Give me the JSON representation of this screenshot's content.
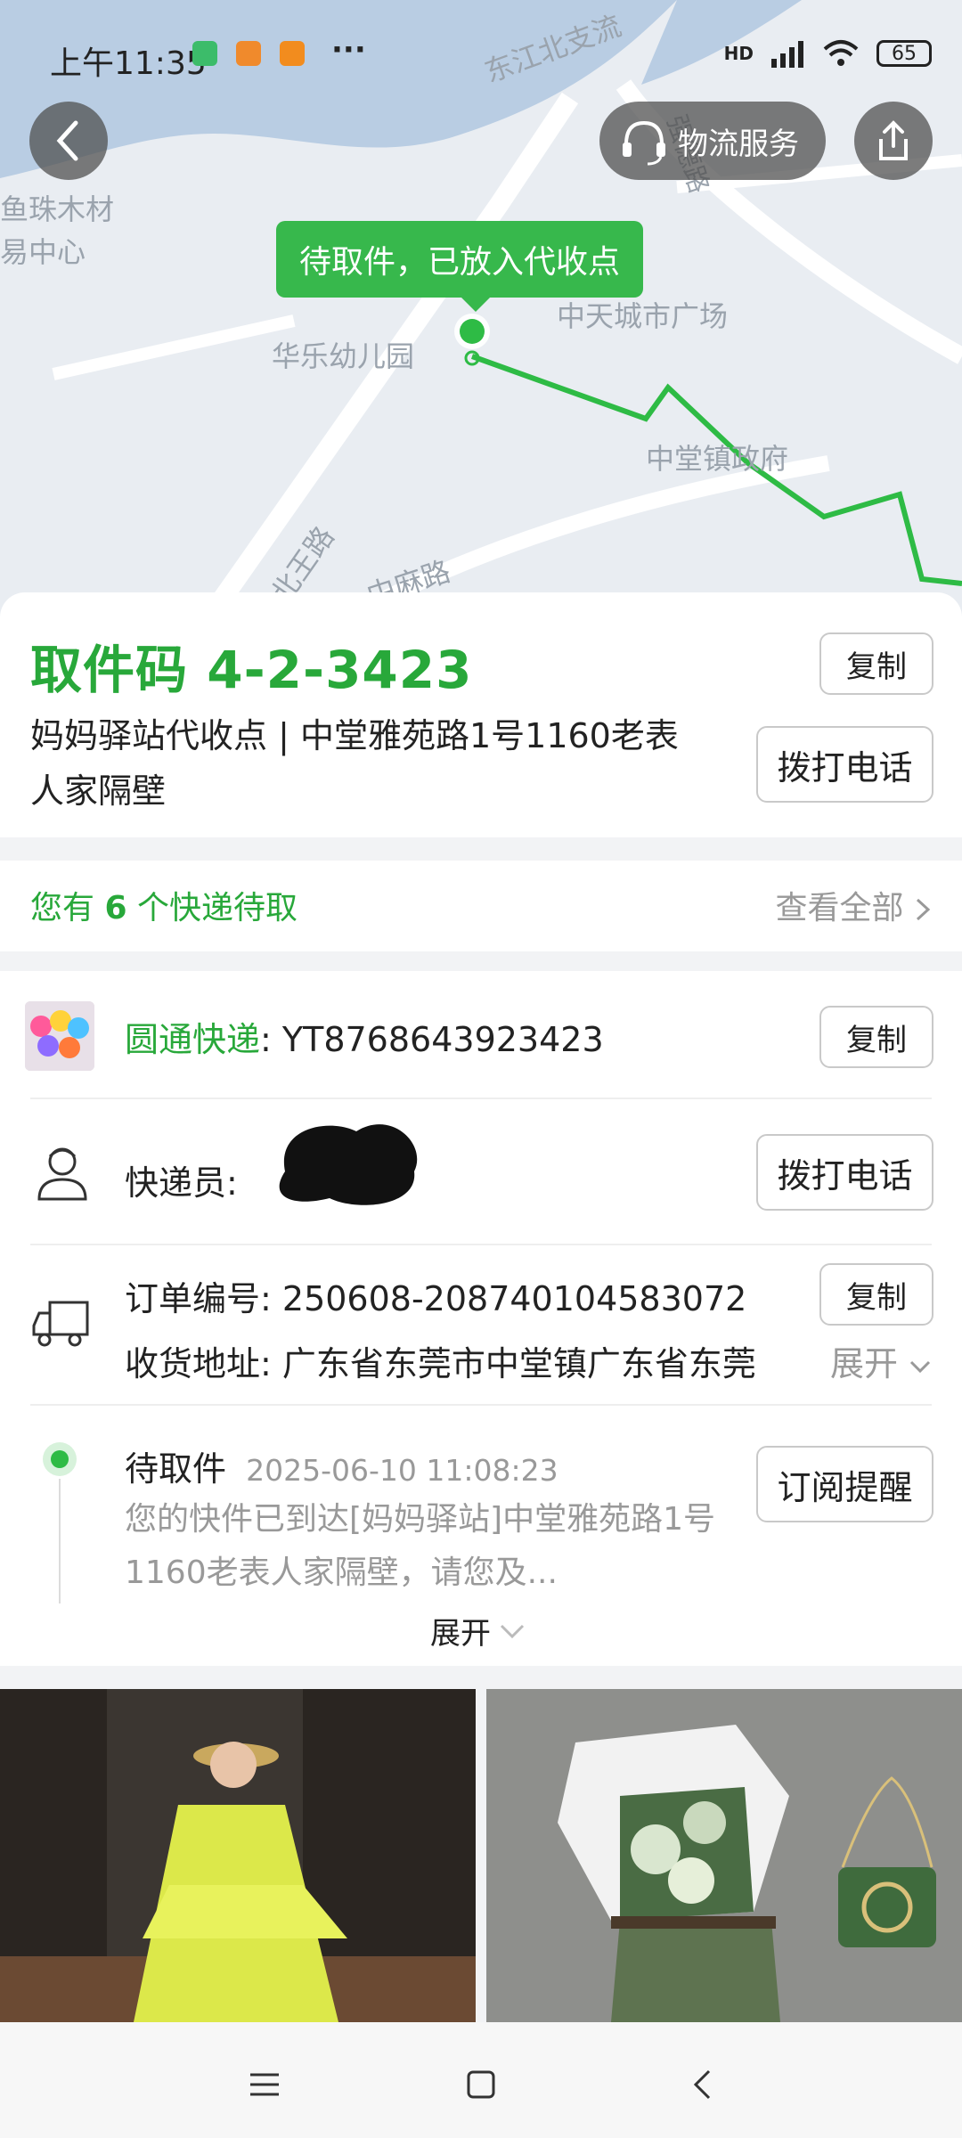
{
  "status_bar": {
    "time": "上午11:35",
    "network": "HD",
    "battery": "65",
    "more": "···"
  },
  "map": {
    "labels": {
      "river": "东江北支流",
      "road_top": "强德路",
      "timber_1": "鱼珠木材",
      "timber_2": "易中心",
      "kindergarten": "华乐幼儿园",
      "plaza": "中天城市广场",
      "government": "中堂镇政府",
      "road_left": "北王路",
      "road_bottom": "中麻路"
    },
    "bubble": "待取件，已放入代收点"
  },
  "header": {
    "back_icon": "back-arrow-icon",
    "logistics_service_label": "物流服务",
    "share_icon": "share-icon"
  },
  "pickup": {
    "code_label": "取件码",
    "code": "4-2-3423",
    "address": "妈妈驿站代收点 | 中堂雅苑路1号1160老表人家隔壁",
    "copy_label": "复制",
    "call_label": "拨打电话"
  },
  "pending": {
    "text_before": "您有 ",
    "count": "6",
    "text_after": " 个快递待取",
    "view_all": "查看全部"
  },
  "shipment": {
    "carrier": "圆通快递",
    "tracking_separator": ": ",
    "tracking_no": "YT8768643923423",
    "copy_label": "复制",
    "courier_label": "快递员: ",
    "call_label": "拨打电话",
    "order_label": "订单编号: ",
    "order_no": "250608-208740104583072",
    "order_copy_label": "复制",
    "address_label": "收货地址: ",
    "address": "广东省东莞市中堂镇广东省东莞",
    "expand_label": "展开"
  },
  "timeline": {
    "status": "待取件",
    "timestamp": "2025-06-10 11:08:23",
    "message": "您的快件已到达[妈妈驿站]中堂雅苑路1号1160老表人家隔壁，请您及...",
    "subscribe_label": "订阅提醒",
    "expand_label": "展开"
  },
  "colors": {
    "brand_green": "#28a83a",
    "route_green": "#2ebb45"
  }
}
